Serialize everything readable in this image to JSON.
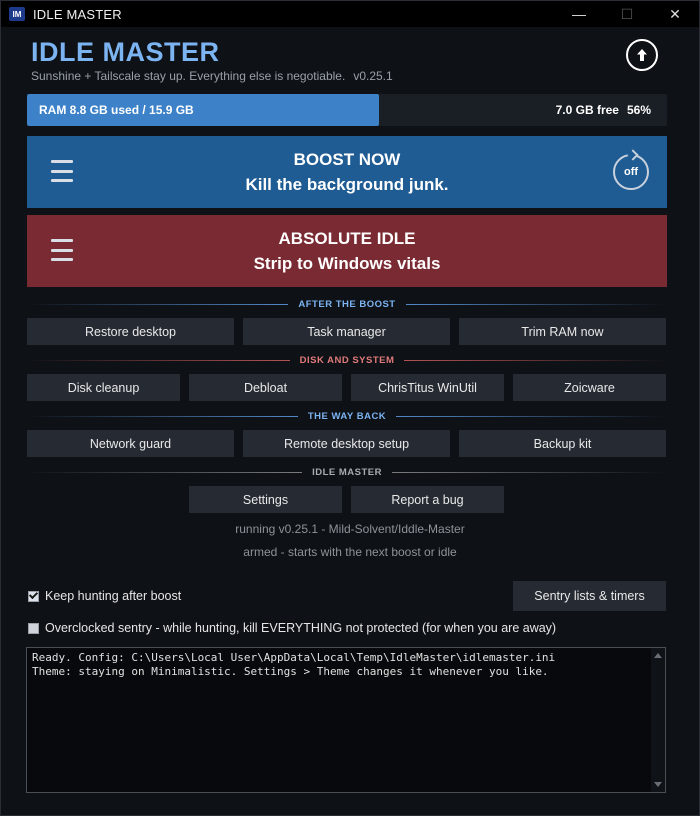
{
  "window": {
    "icon_text": "IM",
    "title": "IDLE MASTER",
    "minimize": "—",
    "maximize": "☐",
    "close": "✕"
  },
  "header": {
    "title": "IDLE MASTER",
    "tagline": "Sunshine + Tailscale stay up. Everything else is negotiable.",
    "version": "v0.25.1"
  },
  "ram": {
    "used_label": "RAM  8.8 GB used / 15.9 GB",
    "free_label": "7.0 GB free",
    "free_percent": "56%",
    "used_fraction": 0.55
  },
  "boost": {
    "line1": "BOOST NOW",
    "line2": "Kill the background junk.",
    "toggle_label": "off"
  },
  "idle": {
    "line1": "ABSOLUTE IDLE",
    "line2": "Strip to Windows vitals"
  },
  "sections": {
    "after_boost": {
      "label": "AFTER THE BOOST",
      "buttons": [
        "Restore desktop",
        "Task manager",
        "Trim RAM now"
      ]
    },
    "disk_system": {
      "label": "DISK AND SYSTEM",
      "buttons": [
        "Disk cleanup",
        "Debloat",
        "ChrisTitus WinUtil",
        "Zoicware"
      ]
    },
    "way_back": {
      "label": "THE WAY BACK",
      "buttons": [
        "Network guard",
        "Remote desktop setup",
        "Backup kit"
      ]
    },
    "idle_master": {
      "label": "IDLE MASTER",
      "buttons": [
        "Settings",
        "Report a bug"
      ]
    }
  },
  "status": {
    "running": "running v0.25.1 - Mild-Solvent/Iddle-Master",
    "armed": "armed - starts with the next boost or idle"
  },
  "options": {
    "keep_hunting": "Keep hunting after boost",
    "sentry_button": "Sentry lists & timers",
    "overclocked": "Overclocked sentry - while hunting, kill EVERYTHING not protected (for when you are away)"
  },
  "log": {
    "text": "Ready. Config: C:\\Users\\Local User\\AppData\\Local\\Temp\\IdleMaster\\idlemaster.ini\nTheme: staying on Minimalistic. Settings > Theme changes it whenever you like."
  }
}
